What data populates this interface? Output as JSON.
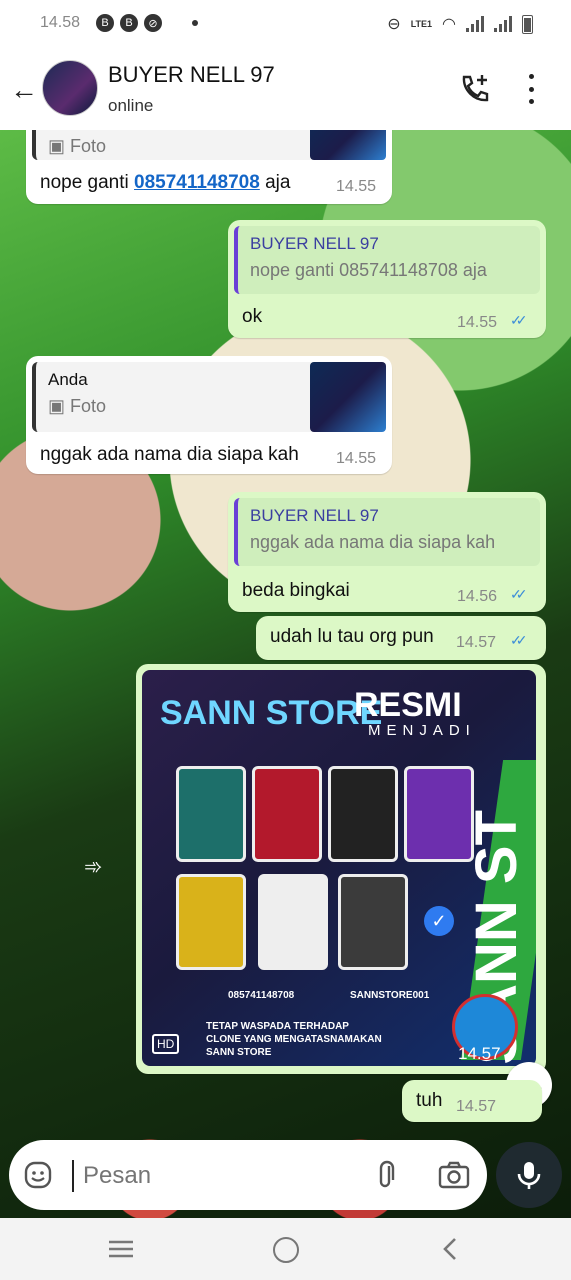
{
  "statusbar": {
    "time": "14.58",
    "network": "LTE1",
    "carrier_icons": [
      "B",
      "B"
    ]
  },
  "header": {
    "contact_name": "BUYER NELL 97",
    "status": "online"
  },
  "messages": {
    "m1": {
      "photo_label": "Foto",
      "text_prefix": "nope ganti",
      "phone": "085741148708",
      "text_suffix": "aja",
      "time": "14.55"
    },
    "m2": {
      "quote_name": "BUYER NELL 97",
      "quote_text": "nope ganti 085741148708 aja",
      "text": "ok",
      "time": "14.55"
    },
    "m3": {
      "quote_name": "Anda",
      "photo_label": "Foto",
      "text": "nggak ada nama dia siapa kah",
      "time": "14.55"
    },
    "m4": {
      "quote_name": "BUYER NELL 97",
      "quote_text": "nggak ada nama dia siapa kah",
      "text": "beda bingkai",
      "time": "14.56"
    },
    "m5": {
      "text": "udah lu tau org pun",
      "time": "14.57"
    },
    "m6": {
      "time": "14.57",
      "poster": {
        "title": "SANN STORE",
        "resmi": "RESMI",
        "menjadi": "MENJADI",
        "side": "SANN ST",
        "phone": "085741148708",
        "instagram": "SANNSTORE001",
        "footer": "TETAP WASPADA TERHADAP\nCLONE YANG MENGATASNAMAKAN\nSANN STORE",
        "hd": "HD"
      }
    },
    "m7": {
      "text": "tuh",
      "time": "14.57"
    }
  },
  "composer": {
    "placeholder": "Pesan"
  },
  "colors": {
    "outgoing": "#dcf8c6",
    "incoming": "#ffffff",
    "tick_read": "#3d8ed8",
    "mic_button": "#1f2a30"
  },
  "icons": [
    "back-arrow-icon",
    "add-call-icon",
    "more-vert-icon",
    "photo-icon",
    "double-check-icon",
    "forward-icon",
    "scroll-down-icon",
    "emoji-icon",
    "attach-icon",
    "camera-icon",
    "mic-icon",
    "nav-menu-icon",
    "nav-home-icon",
    "nav-back-icon"
  ]
}
